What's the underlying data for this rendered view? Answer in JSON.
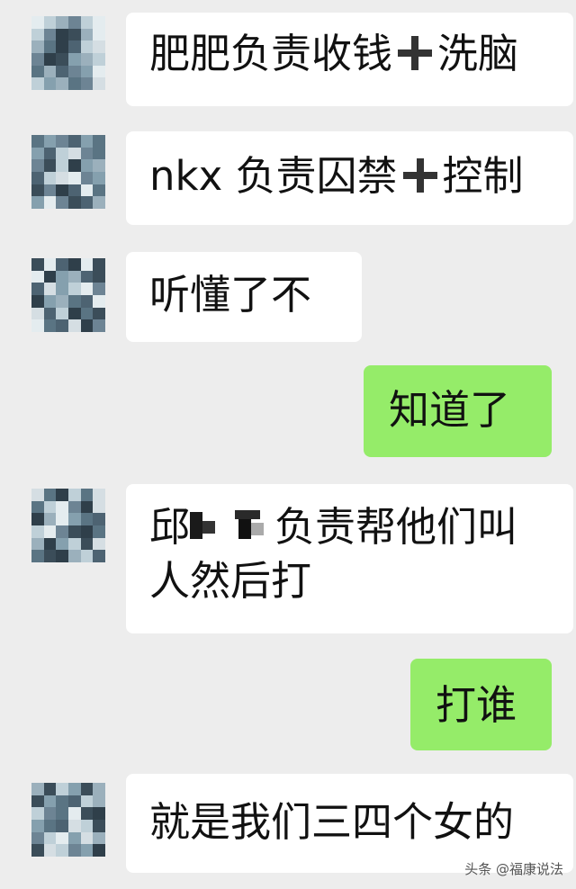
{
  "messages": [
    {
      "side": "left",
      "parts": [
        "肥肥负责收钱",
        "洗脑"
      ]
    },
    {
      "side": "left",
      "parts": [
        "nkx 负责囚禁",
        "控制"
      ]
    },
    {
      "side": "left",
      "text": "听懂了不"
    },
    {
      "side": "right",
      "text": "知道了"
    },
    {
      "side": "left",
      "line1_start": "邱",
      "line1_end": "负责帮他们叫",
      "line2": "人然后打"
    },
    {
      "side": "right",
      "text": "打谁"
    },
    {
      "side": "left",
      "text": "就是我们三四个女的"
    }
  ],
  "watermark": "头条 @福康说法",
  "colors": {
    "background": "#ededed",
    "incoming_bubble": "#ffffff",
    "outgoing_bubble": "#95ec69"
  },
  "icons": [
    "plus-icon",
    "pixelated-avatar"
  ]
}
